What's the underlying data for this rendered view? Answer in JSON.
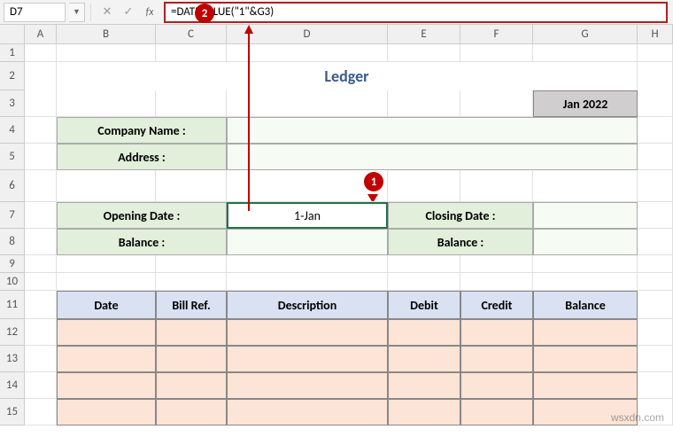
{
  "formula_bar": {
    "cell_ref": "D7",
    "formula": "=DATEVALUE(\"1\"&G3)"
  },
  "callouts": {
    "c1": "1",
    "c2": "2"
  },
  "columns": [
    "A",
    "B",
    "C",
    "D",
    "E",
    "F",
    "G",
    "H"
  ],
  "rows": [
    "1",
    "2",
    "3",
    "4",
    "5",
    "6",
    "7",
    "8",
    "9",
    "10",
    "11",
    "12",
    "13",
    "14",
    "15"
  ],
  "ledger": {
    "title": "Ledger",
    "period": "Jan 2022",
    "company_label": "Company Name :",
    "address_label": "Address :",
    "opening_date_label": "Opening Date :",
    "opening_date_value": "1-Jan",
    "closing_date_label": "Closing Date :",
    "balance_label": "Balance :"
  },
  "table": {
    "headers": {
      "date": "Date",
      "bill": "Bill Ref.",
      "desc": "Description",
      "debit": "Debit",
      "credit": "Credit",
      "balance": "Balance"
    }
  },
  "watermark": "wsxdn.com"
}
